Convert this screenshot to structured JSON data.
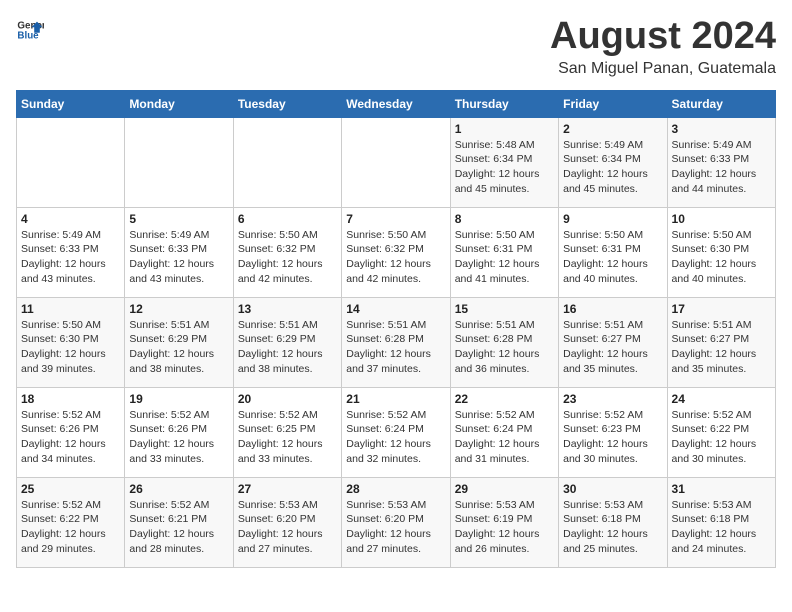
{
  "header": {
    "logo_line1": "General",
    "logo_line2": "Blue",
    "main_title": "August 2024",
    "subtitle": "San Miguel Panan, Guatemala"
  },
  "days_of_week": [
    "Sunday",
    "Monday",
    "Tuesday",
    "Wednesday",
    "Thursday",
    "Friday",
    "Saturday"
  ],
  "weeks": [
    [
      {
        "day": "",
        "info": ""
      },
      {
        "day": "",
        "info": ""
      },
      {
        "day": "",
        "info": ""
      },
      {
        "day": "",
        "info": ""
      },
      {
        "day": "1",
        "info": "Sunrise: 5:48 AM\nSunset: 6:34 PM\nDaylight: 12 hours\nand 45 minutes."
      },
      {
        "day": "2",
        "info": "Sunrise: 5:49 AM\nSunset: 6:34 PM\nDaylight: 12 hours\nand 45 minutes."
      },
      {
        "day": "3",
        "info": "Sunrise: 5:49 AM\nSunset: 6:33 PM\nDaylight: 12 hours\nand 44 minutes."
      }
    ],
    [
      {
        "day": "4",
        "info": "Sunrise: 5:49 AM\nSunset: 6:33 PM\nDaylight: 12 hours\nand 43 minutes."
      },
      {
        "day": "5",
        "info": "Sunrise: 5:49 AM\nSunset: 6:33 PM\nDaylight: 12 hours\nand 43 minutes."
      },
      {
        "day": "6",
        "info": "Sunrise: 5:50 AM\nSunset: 6:32 PM\nDaylight: 12 hours\nand 42 minutes."
      },
      {
        "day": "7",
        "info": "Sunrise: 5:50 AM\nSunset: 6:32 PM\nDaylight: 12 hours\nand 42 minutes."
      },
      {
        "day": "8",
        "info": "Sunrise: 5:50 AM\nSunset: 6:31 PM\nDaylight: 12 hours\nand 41 minutes."
      },
      {
        "day": "9",
        "info": "Sunrise: 5:50 AM\nSunset: 6:31 PM\nDaylight: 12 hours\nand 40 minutes."
      },
      {
        "day": "10",
        "info": "Sunrise: 5:50 AM\nSunset: 6:30 PM\nDaylight: 12 hours\nand 40 minutes."
      }
    ],
    [
      {
        "day": "11",
        "info": "Sunrise: 5:50 AM\nSunset: 6:30 PM\nDaylight: 12 hours\nand 39 minutes."
      },
      {
        "day": "12",
        "info": "Sunrise: 5:51 AM\nSunset: 6:29 PM\nDaylight: 12 hours\nand 38 minutes."
      },
      {
        "day": "13",
        "info": "Sunrise: 5:51 AM\nSunset: 6:29 PM\nDaylight: 12 hours\nand 38 minutes."
      },
      {
        "day": "14",
        "info": "Sunrise: 5:51 AM\nSunset: 6:28 PM\nDaylight: 12 hours\nand 37 minutes."
      },
      {
        "day": "15",
        "info": "Sunrise: 5:51 AM\nSunset: 6:28 PM\nDaylight: 12 hours\nand 36 minutes."
      },
      {
        "day": "16",
        "info": "Sunrise: 5:51 AM\nSunset: 6:27 PM\nDaylight: 12 hours\nand 35 minutes."
      },
      {
        "day": "17",
        "info": "Sunrise: 5:51 AM\nSunset: 6:27 PM\nDaylight: 12 hours\nand 35 minutes."
      }
    ],
    [
      {
        "day": "18",
        "info": "Sunrise: 5:52 AM\nSunset: 6:26 PM\nDaylight: 12 hours\nand 34 minutes."
      },
      {
        "day": "19",
        "info": "Sunrise: 5:52 AM\nSunset: 6:26 PM\nDaylight: 12 hours\nand 33 minutes."
      },
      {
        "day": "20",
        "info": "Sunrise: 5:52 AM\nSunset: 6:25 PM\nDaylight: 12 hours\nand 33 minutes."
      },
      {
        "day": "21",
        "info": "Sunrise: 5:52 AM\nSunset: 6:24 PM\nDaylight: 12 hours\nand 32 minutes."
      },
      {
        "day": "22",
        "info": "Sunrise: 5:52 AM\nSunset: 6:24 PM\nDaylight: 12 hours\nand 31 minutes."
      },
      {
        "day": "23",
        "info": "Sunrise: 5:52 AM\nSunset: 6:23 PM\nDaylight: 12 hours\nand 30 minutes."
      },
      {
        "day": "24",
        "info": "Sunrise: 5:52 AM\nSunset: 6:22 PM\nDaylight: 12 hours\nand 30 minutes."
      }
    ],
    [
      {
        "day": "25",
        "info": "Sunrise: 5:52 AM\nSunset: 6:22 PM\nDaylight: 12 hours\nand 29 minutes."
      },
      {
        "day": "26",
        "info": "Sunrise: 5:52 AM\nSunset: 6:21 PM\nDaylight: 12 hours\nand 28 minutes."
      },
      {
        "day": "27",
        "info": "Sunrise: 5:53 AM\nSunset: 6:20 PM\nDaylight: 12 hours\nand 27 minutes."
      },
      {
        "day": "28",
        "info": "Sunrise: 5:53 AM\nSunset: 6:20 PM\nDaylight: 12 hours\nand 27 minutes."
      },
      {
        "day": "29",
        "info": "Sunrise: 5:53 AM\nSunset: 6:19 PM\nDaylight: 12 hours\nand 26 minutes."
      },
      {
        "day": "30",
        "info": "Sunrise: 5:53 AM\nSunset: 6:18 PM\nDaylight: 12 hours\nand 25 minutes."
      },
      {
        "day": "31",
        "info": "Sunrise: 5:53 AM\nSunset: 6:18 PM\nDaylight: 12 hours\nand 24 minutes."
      }
    ]
  ]
}
